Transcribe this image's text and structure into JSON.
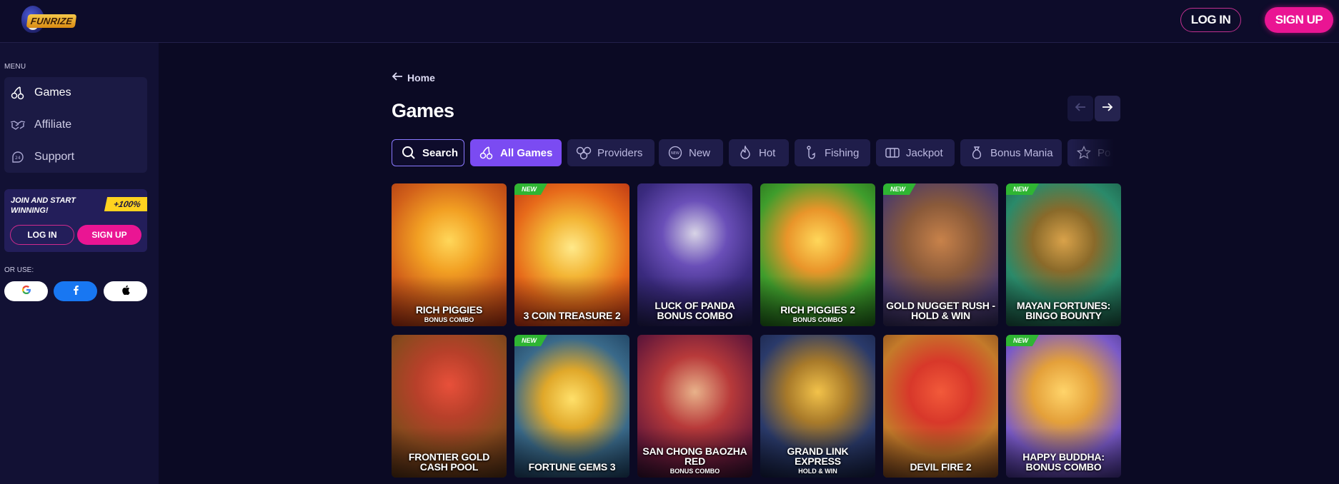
{
  "header": {
    "logo_text": "FUNRIZE",
    "login_label": "LOG IN",
    "signup_label": "SIGN UP"
  },
  "sidebar": {
    "menu_label": "MENU",
    "items": [
      {
        "label": "Games",
        "icon": "cherries-icon",
        "active": true
      },
      {
        "label": "Affiliate",
        "icon": "handshake-icon",
        "active": false
      },
      {
        "label": "Support",
        "icon": "support-24-icon",
        "active": false
      }
    ],
    "promo": {
      "text": "JOIN AND START WINNING!",
      "badge": "+100%",
      "login_label": "LOG IN",
      "signup_label": "SIGN UP"
    },
    "or_use_label": "OR USE:",
    "social": [
      "google-icon",
      "facebook-icon",
      "apple-icon"
    ]
  },
  "main": {
    "breadcrumb": "Home",
    "title": "Games",
    "tabs": [
      {
        "label": "Search",
        "icon": "search-icon"
      },
      {
        "label": "All Games",
        "icon": "cherries-icon",
        "active": true
      },
      {
        "label": "Providers",
        "icon": "providers-icon"
      },
      {
        "label": "New",
        "icon": "new-icon"
      },
      {
        "label": "Hot",
        "icon": "flame-icon"
      },
      {
        "label": "Fishing",
        "icon": "fishing-hook-icon"
      },
      {
        "label": "Jackpot",
        "icon": "slot-machine-icon"
      },
      {
        "label": "Bonus Mania",
        "icon": "money-bag-icon"
      },
      {
        "label": "Po",
        "icon": "star-icon"
      }
    ],
    "new_badge": "NEW",
    "games": [
      {
        "title": "RICH PIGGIES",
        "subtitle": "BONUS COMBO",
        "new": false
      },
      {
        "title": "3 COIN TREASURE 2",
        "subtitle": "",
        "new": true
      },
      {
        "title": "LUCK OF PANDA BONUS COMBO",
        "subtitle": "",
        "new": false
      },
      {
        "title": "RICH PIGGIES 2",
        "subtitle": "BONUS COMBO",
        "new": false
      },
      {
        "title": "GOLD NUGGET RUSH - HOLD & WIN",
        "subtitle": "",
        "new": true
      },
      {
        "title": "MAYAN FORTUNES: BINGO BOUNTY",
        "subtitle": "",
        "new": true
      },
      {
        "title": "FRONTIER GOLD CASH POOL",
        "subtitle": "",
        "new": false
      },
      {
        "title": "FORTUNE GEMS 3",
        "subtitle": "",
        "new": true
      },
      {
        "title": "SAN CHONG BAOZHA RED",
        "subtitle": "BONUS COMBO",
        "new": false
      },
      {
        "title": "GRAND LINK EXPRESS",
        "subtitle": "HOLD & WIN",
        "new": false
      },
      {
        "title": "DEVIL FIRE 2",
        "subtitle": "",
        "new": false
      },
      {
        "title": "HAPPY BUDDHA: BONUS COMBO",
        "subtitle": "",
        "new": true
      }
    ]
  }
}
